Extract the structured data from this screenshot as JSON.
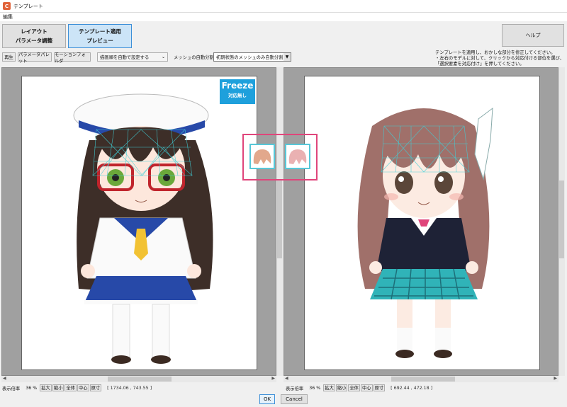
{
  "window": {
    "title": "テンプレート",
    "icon_glyph": "C"
  },
  "menu": {
    "edit": "編集"
  },
  "mode_buttons": {
    "layout": "レイアウト",
    "param_adjust": "パラメータ調整",
    "apply_template": "テンプレート適用",
    "preview": "プレビュー"
  },
  "help_button": "ヘルプ",
  "instructions": {
    "line1": "テンプレートを適用し、おかしな部分を修正してください。",
    "line2": "・左右のモデルに対して、クリックから対応付ける部位を選び、",
    "line3": "「選択要素を対応付け」を押してください。"
  },
  "toolbar": {
    "play": "再生",
    "param_palette": "パラメータパレット",
    "motion_folder": "モーションフォルダ",
    "draw_order": "描画順を自動で設定する",
    "mesh_split_label": "メッシュの自動分割",
    "mesh_split_value": "初期状態のメッシュのみ自動分割"
  },
  "freeze_badge": {
    "title": "Freeze",
    "subtitle": "対応無し"
  },
  "left_status": {
    "zoom_label": "表示倍率",
    "zoom_value": "36 %",
    "zoom_in": "拡大",
    "zoom_out": "縮小",
    "fit_all": "全体",
    "center": "中心",
    "actual": "原寸",
    "coords": "[ 1734.06 , 743.55 ]"
  },
  "right_status": {
    "zoom_label": "表示倍率",
    "zoom_value": "36 %",
    "zoom_in": "拡大",
    "zoom_out": "縮小",
    "fit_all": "全体",
    "center": "中心",
    "actual": "原寸",
    "coords": "[ 692.44 , 472.18 ]"
  },
  "footer": {
    "ok": "OK",
    "cancel": "Cancel"
  },
  "colors": {
    "accent": "#3c8fd8",
    "freeze": "#1ea0dc",
    "highlight": "#e0457b",
    "mesh": "#3fd0d8"
  }
}
